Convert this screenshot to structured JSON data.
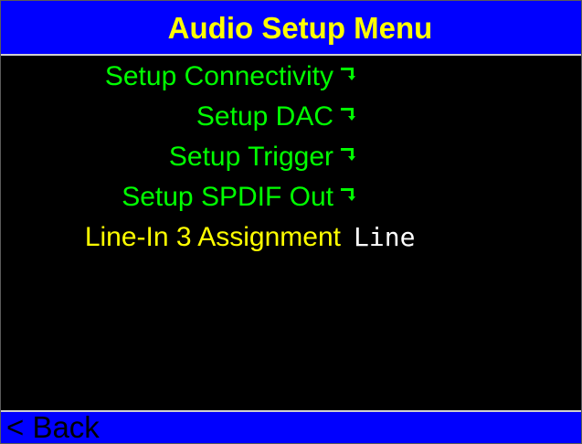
{
  "title": "Audio Setup Menu",
  "menu": {
    "items": [
      {
        "label": "Setup Connectivity",
        "submenu_icon": "submenu-arrow-icon"
      },
      {
        "label": "Setup DAC",
        "submenu_icon": "submenu-arrow-icon"
      },
      {
        "label": "Setup Trigger",
        "submenu_icon": "submenu-arrow-icon"
      },
      {
        "label": "Setup SPDIF Out",
        "submenu_icon": "submenu-arrow-icon"
      }
    ],
    "selected": {
      "label": "Line-In 3 Assignment",
      "value": "Line"
    }
  },
  "footer": {
    "back_label": "< Back"
  },
  "colors": {
    "background": "#000000",
    "bar": "#0000ff",
    "title": "#ffff00",
    "item": "#00ff00",
    "selected": "#ffff00",
    "value": "#ffffff",
    "back": "#000000"
  }
}
